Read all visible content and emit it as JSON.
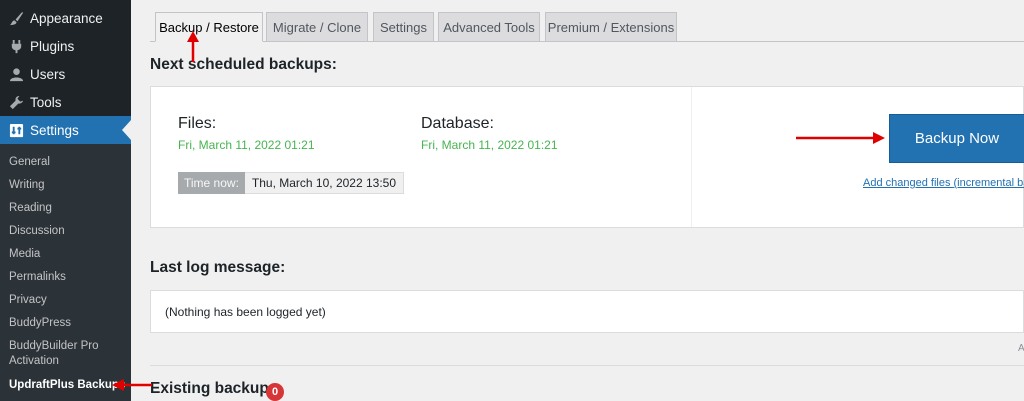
{
  "sidebar": {
    "menu": [
      {
        "label": "Appearance",
        "icon": "paintbrush-icon"
      },
      {
        "label": "Plugins",
        "icon": "plug-icon"
      },
      {
        "label": "Users",
        "icon": "user-icon"
      },
      {
        "label": "Tools",
        "icon": "wrench-icon"
      },
      {
        "label": "Settings",
        "icon": "settings-icon",
        "active": true
      }
    ],
    "submenu": [
      "General",
      "Writing",
      "Reading",
      "Discussion",
      "Media",
      "Permalinks",
      "Privacy",
      "BuddyPress",
      "BuddyBuilder Pro",
      "Activation",
      "UpdraftPlus Backups"
    ]
  },
  "tabs": [
    "Backup / Restore",
    "Migrate / Clone",
    "Settings",
    "Advanced Tools",
    "Premium / Extensions"
  ],
  "scheduled": {
    "heading": "Next scheduled backups:",
    "files_label": "Files:",
    "files_date": "Fri, March 11, 2022 01:21",
    "db_label": "Database:",
    "db_date": "Fri, March 11, 2022 01:21",
    "time_now_label": "Time now:",
    "time_now_value": "Thu, March 10, 2022 13:50",
    "backup_button": "Backup Now",
    "incremental_link": "Add changed files (incremental ba"
  },
  "log": {
    "heading": "Last log message:",
    "message": "(Nothing has been logged yet)"
  },
  "existing": {
    "heading": "Existing backups",
    "count": "0"
  },
  "edge_char": "A",
  "colors": {
    "accent": "#2271b1",
    "sidebar": "#1d2327",
    "date_green": "#46b450",
    "badge": "#d63638",
    "annotation": "#e00000"
  }
}
